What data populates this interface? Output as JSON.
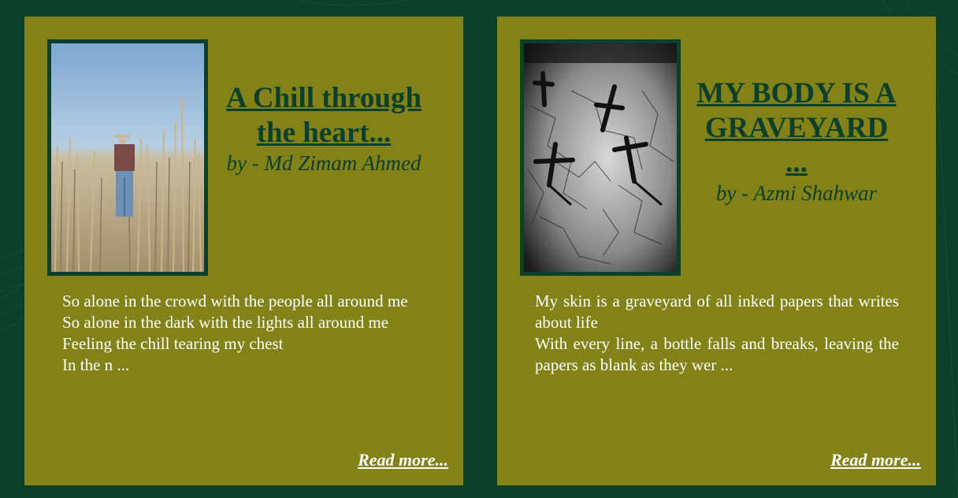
{
  "cards": [
    {
      "title": "A Chill through the heart...",
      "author": "by - Md Zimam Ahmed",
      "image": "man-in-cornfield-photo",
      "excerpt": [
        "So alone in the crowd with the people all around me",
        "So alone in the dark with the lights all around me",
        "Feeling the chill tearing my chest",
        "In the n ..."
      ],
      "read_more": "Read more..."
    },
    {
      "title": "MY BODY IS A GRAVEYARD ...",
      "author": "by - Azmi Shahwar",
      "image": "graveyard-crosses-photo",
      "excerpt": [
        "My skin is a graveyard of all inked papers that writes about life",
        "With every line, a bottle falls and breaks, leaving the papers as blank as they wer ..."
      ],
      "read_more": "Read more..."
    }
  ],
  "colors": {
    "background": "#0c3f2c",
    "card": "#828219",
    "title": "#0c3f2c",
    "text": "#ffffff"
  }
}
